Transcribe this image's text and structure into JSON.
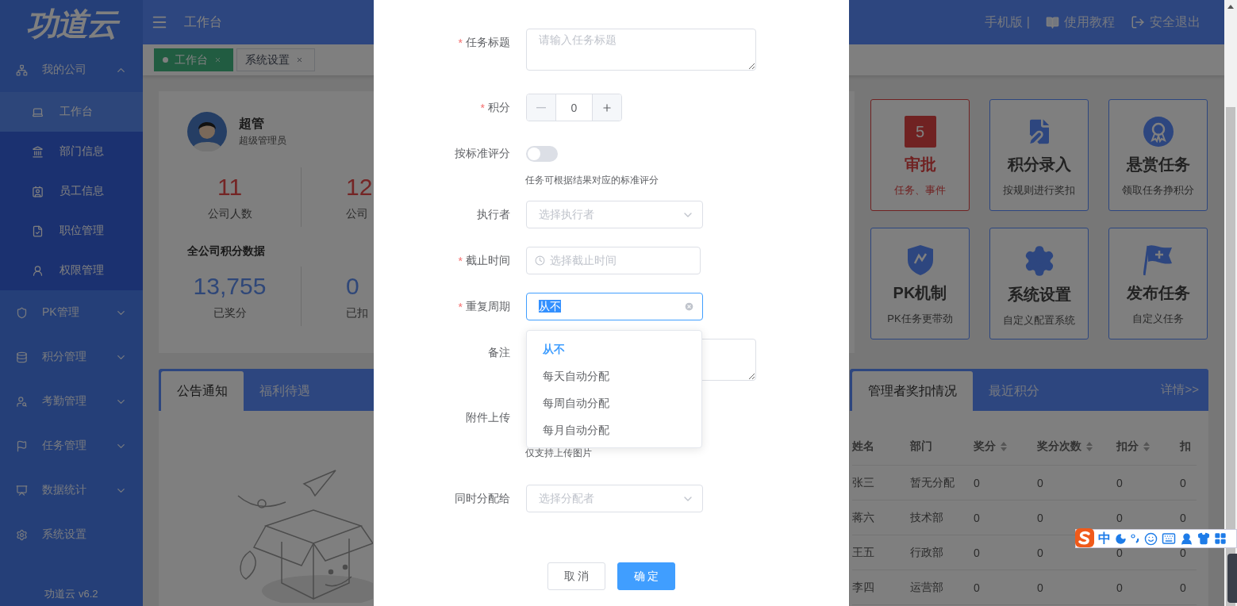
{
  "sidebar": {
    "logo": "功道云",
    "menu": [
      {
        "kind": "group",
        "label": "我的公司",
        "expanded": true,
        "children": [
          {
            "label": "工作台",
            "selected": true
          },
          {
            "label": "部门信息",
            "selected": false
          },
          {
            "label": "员工信息",
            "selected": false
          },
          {
            "label": "职位管理",
            "selected": false
          },
          {
            "label": "权限管理",
            "selected": false
          }
        ]
      },
      {
        "kind": "group",
        "label": "PK管理",
        "expanded": false
      },
      {
        "kind": "group",
        "label": "积分管理",
        "expanded": false
      },
      {
        "kind": "group",
        "label": "考勤管理",
        "expanded": false
      },
      {
        "kind": "group",
        "label": "任务管理",
        "expanded": false
      },
      {
        "kind": "group",
        "label": "数据统计",
        "expanded": false
      },
      {
        "kind": "link",
        "label": "系统设置"
      }
    ],
    "version": "功道云 v6.2"
  },
  "header": {
    "title": "工作台",
    "mobile": "手机版 |",
    "tutorial": "使用教程",
    "logout": "安全退出"
  },
  "page_tabs": [
    {
      "label": "工作台",
      "selected": true
    },
    {
      "label": "系统设置",
      "selected": false
    }
  ],
  "profile": {
    "name": "超管",
    "role": "超级管理员",
    "company_stats": [
      {
        "value": "11",
        "label": "公司人数"
      },
      {
        "value": "12",
        "label": "公司"
      }
    ],
    "points_title": "全公司积分数据",
    "point_stats": [
      {
        "value": "13,755",
        "label": "已奖分"
      },
      {
        "value": "0",
        "label": "已扣"
      }
    ]
  },
  "shortcuts": [
    {
      "title": "审批",
      "subtitle": "任务、事件",
      "badge": "5",
      "alert": true
    },
    {
      "title": "积分录入",
      "subtitle": "按规则进行奖扣",
      "alert": false
    },
    {
      "title": "悬赏任务",
      "subtitle": "领取任务挣积分",
      "alert": false
    },
    {
      "title": "PK机制",
      "subtitle": "PK任务更带劲",
      "alert": false
    },
    {
      "title": "系统设置",
      "subtitle": "自定义配置系统",
      "alert": false
    },
    {
      "title": "发布任务",
      "subtitle": "自定义任务",
      "alert": false
    }
  ],
  "notice_panel": {
    "tabs": [
      {
        "label": "公告通知",
        "selected": true
      },
      {
        "label": "福利待遇",
        "selected": false
      }
    ]
  },
  "ranking_panel": {
    "tabs": [
      {
        "label": "管理者奖扣情况",
        "selected": true
      },
      {
        "label": "最近积分",
        "selected": false
      }
    ],
    "more": "详情>>",
    "columns": [
      {
        "label": "姓名",
        "sortable": false
      },
      {
        "label": "部门",
        "sortable": false
      },
      {
        "label": "奖分",
        "sortable": true
      },
      {
        "label": "奖分次数",
        "sortable": true
      },
      {
        "label": "扣分",
        "sortable": true
      },
      {
        "label": "扣",
        "sortable": false
      }
    ],
    "rows": [
      [
        "张三",
        "暂无分配",
        "0",
        "0",
        "0",
        "0"
      ],
      [
        "蒋六",
        "技术部",
        "0",
        "0",
        "0",
        "0"
      ],
      [
        "王五",
        "行政部",
        "0",
        "0",
        "0",
        "0"
      ],
      [
        "李四",
        "运营部",
        "0",
        "0",
        "0",
        "0"
      ]
    ]
  },
  "dialog": {
    "fields": [
      {
        "kind": "textarea",
        "required_mark": "*",
        "label": "任务标题",
        "placeholder": "请输入任务标题"
      },
      {
        "kind": "number",
        "required_mark": "*",
        "label": "积分",
        "value": "0"
      },
      {
        "kind": "switch",
        "label": "按标准评分",
        "on": false,
        "hint": "任务可根据结果对应的标准评分"
      },
      {
        "kind": "select",
        "label": "执行者",
        "placeholder": "选择执行者",
        "focused": false
      },
      {
        "kind": "date",
        "required_mark": "*",
        "label": "截止时间",
        "placeholder": "选择截止时间"
      },
      {
        "kind": "select",
        "required_mark": "*",
        "label": "重复周期",
        "value": "从不",
        "focused": true
      },
      {
        "kind": "textarea",
        "label": "备注"
      },
      {
        "kind": "upload",
        "label": "附件上传",
        "hint": "仅支持上传图片"
      },
      {
        "kind": "select",
        "label": "同时分配给",
        "placeholder": "选择分配者",
        "focused": false
      }
    ],
    "dropdown": [
      {
        "label": "从不",
        "selected": true
      },
      {
        "label": "每天自动分配",
        "selected": false
      },
      {
        "label": "每周自动分配",
        "selected": false
      },
      {
        "label": "每月自动分配",
        "selected": false
      }
    ],
    "buttons": [
      {
        "label": "取 消",
        "kind": "default"
      },
      {
        "label": "确 定",
        "kind": "primary"
      }
    ]
  },
  "ime": {
    "mode": "中"
  }
}
